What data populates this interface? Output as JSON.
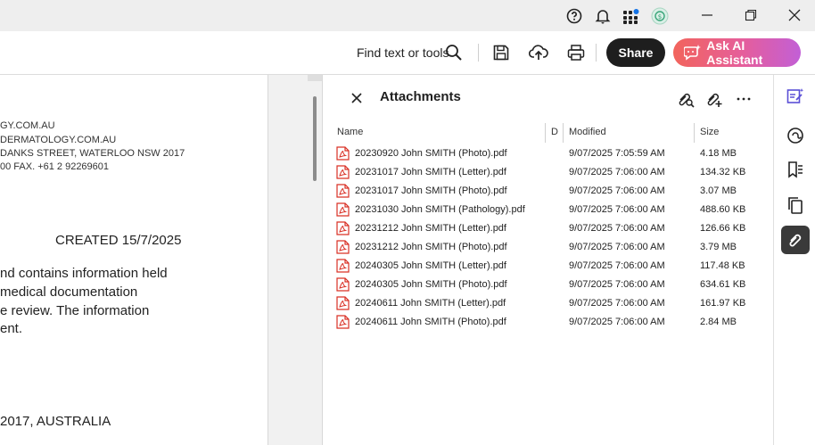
{
  "titlebar": {
    "icons": [
      "help-icon",
      "bell-icon",
      "apps-grid-icon",
      "account-avatar-icon"
    ],
    "window_controls": [
      "minimize-icon",
      "restore-icon",
      "close-icon"
    ]
  },
  "toolbar": {
    "find_label": "Find text or tools",
    "share_label": "Share",
    "ai_label": "Ask AI Assistant",
    "icons": [
      "search-icon",
      "save-icon",
      "upload-cloud-icon",
      "print-icon",
      "ai-assistant-icon"
    ]
  },
  "document": {
    "lines_small": [
      "GY.COM.AU",
      "DERMATOLOGY.COM.AU",
      " DANKS STREET, WATERLOO NSW 2017",
      "00  FAX.   +61 2 92269601"
    ],
    "created": "CREATED  15/7/2025",
    "body_lines": [
      "nd contains information held",
      "medical documentation",
      "e review. The information",
      "ent."
    ],
    "address_tail": "2017, AUSTRALIA"
  },
  "attachments": {
    "title": "Attachments",
    "columns": {
      "name": "Name",
      "desc": "D",
      "modified": "Modified",
      "size": "Size"
    },
    "files": [
      {
        "name": "20230920 John SMITH (Photo).pdf",
        "modified": "9/07/2025 7:05:59 AM",
        "size": "4.18 MB"
      },
      {
        "name": "20231017 John SMITH (Letter).pdf",
        "modified": "9/07/2025 7:06:00 AM",
        "size": "134.32 KB"
      },
      {
        "name": "20231017 John SMITH (Photo).pdf",
        "modified": "9/07/2025 7:06:00 AM",
        "size": "3.07 MB"
      },
      {
        "name": "20231030 John SMITH (Pathology).pdf",
        "modified": "9/07/2025 7:06:00 AM",
        "size": "488.60 KB"
      },
      {
        "name": "20231212 John SMITH (Letter).pdf",
        "modified": "9/07/2025 7:06:00 AM",
        "size": "126.66 KB"
      },
      {
        "name": "20231212 John SMITH (Photo).pdf",
        "modified": "9/07/2025 7:06:00 AM",
        "size": "3.79 MB"
      },
      {
        "name": "20240305 John SMITH (Letter).pdf",
        "modified": "9/07/2025 7:06:00 AM",
        "size": "117.48 KB"
      },
      {
        "name": "20240305 John SMITH (Photo).pdf",
        "modified": "9/07/2025 7:06:00 AM",
        "size": "634.61 KB"
      },
      {
        "name": "20240611 John SMITH (Letter).pdf",
        "modified": "9/07/2025 7:06:00 AM",
        "size": "161.97 KB"
      },
      {
        "name": "20240611 John SMITH (Photo).pdf",
        "modified": "9/07/2025 7:06:00 AM",
        "size": "2.84 MB"
      }
    ],
    "actions": [
      "search-attachment-icon",
      "add-attachment-icon",
      "more-options-icon"
    ]
  },
  "rail": {
    "items": [
      "edit-pdf-icon",
      "comment-icon",
      "bookmarks-icon",
      "pages-icon",
      "attachments-icon"
    ],
    "active": "attachments-icon"
  },
  "colors": {
    "share_bg": "#1e1e1e",
    "ai_gradient_start": "#f2645c",
    "ai_gradient_end": "#c25fd6",
    "pdf_red": "#d93025",
    "rail_active": "#3a3a3a"
  }
}
